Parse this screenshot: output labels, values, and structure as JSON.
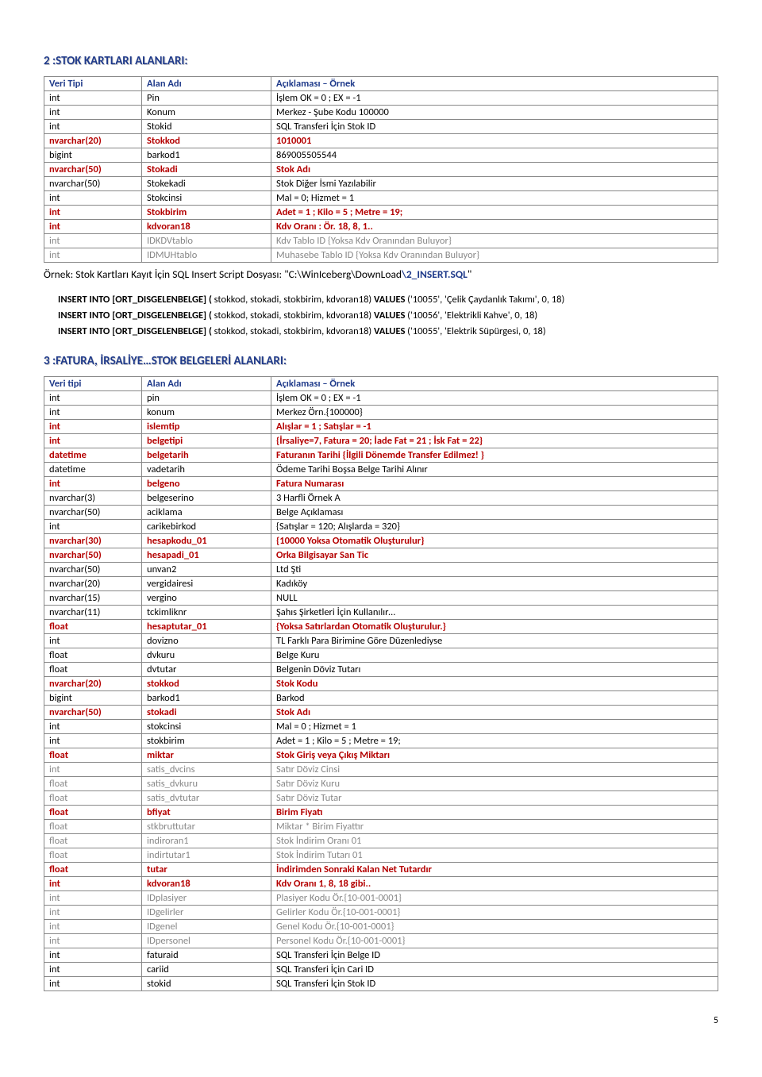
{
  "page_number": "5",
  "section2": {
    "heading": "2 :STOK KARTLARI ALANLARI:",
    "headers": {
      "type": "Veri Tipi",
      "name": "Alan Adı",
      "desc": "Açıklaması – Örnek"
    },
    "rows": [
      {
        "type": "int",
        "name": "Pin",
        "desc": "İşlem OK = 0 ; EX = -1",
        "cls": ""
      },
      {
        "type": "int",
        "name": "Konum",
        "desc": "Merkez - Şube Kodu 100000",
        "cls": ""
      },
      {
        "type": "int",
        "name": "Stokid",
        "desc": "SQL Transferi İçin Stok ID",
        "cls": ""
      },
      {
        "type": "nvarchar(20)",
        "name": "Stokkod",
        "desc": "1010001",
        "cls": "redrow"
      },
      {
        "type": "bigint",
        "name": "barkod1",
        "desc": "869005505544",
        "cls": ""
      },
      {
        "type": "nvarchar(50)",
        "name": "Stokadi",
        "desc": "Stok Adı",
        "cls": "redrow"
      },
      {
        "type": "nvarchar(50)",
        "name": "Stokekadi",
        "desc": "Stok Diğer İsmi Yazılabilir",
        "cls": ""
      },
      {
        "type": "int",
        "name": "Stokcinsi",
        "desc": "Mal = 0; Hizmet = 1",
        "cls": ""
      },
      {
        "type": "int",
        "name": "Stokbirim",
        "desc": "Adet = 1 ; Kilo = 5 ; Metre = 19;",
        "cls": "redrow"
      },
      {
        "type": "int",
        "name": "kdvoran18",
        "desc": "Kdv Oranı : Ör. 18, 8, 1..",
        "cls": "redrow"
      },
      {
        "type": "int",
        "name": "IDKDVtablo",
        "desc": "Kdv Tablo ID {Yoksa Kdv Oranından Buluyor}",
        "cls": "grayrow"
      },
      {
        "type": "int",
        "name": "IDMUHtablo",
        "desc": "Muhasebe Tablo ID {Yoksa Kdv Oranından Buluyor}",
        "cls": "grayrow"
      }
    ],
    "example_prefix": "Örnek: Stok Kartları Kayıt İçin SQL Insert Script Dosyası: \"C:\\WinIceberg\\DownLoad",
    "example_bold": "\\2_INSERT.SQL",
    "example_suffix": "\"",
    "sql": [
      {
        "k1": "INSERT INTO [ORT_DISGELENBELGE]",
        "k2": "(",
        "mid": " stokkod, stokadi, stokbirim, kdvoran18) ",
        "k3": "VALUES",
        "tail": " ('10055', 'Çelik Çaydanlık Takımı', 0, 18)"
      },
      {
        "k1": "INSERT INTO [ORT_DISGELENBELGE]",
        "k2": "(",
        "mid": " stokkod, stokadi, stokbirim, kdvoran18) ",
        "k3": "VALUES",
        "tail": " ('10056', 'Elektrikli Kahve', 0, 18)"
      },
      {
        "k1": "INSERT INTO [ORT_DISGELENBELGE]",
        "k2": "(",
        "mid": " stokkod, stokadi, stokbirim, kdvoran18) ",
        "k3": "VALUES",
        "tail": " ('10055', 'Elektrik Süpürgesi, 0, 18)"
      }
    ]
  },
  "section3": {
    "heading": "3 :FATURA, İRSALİYE…STOK BELGELERİ ALANLARI:",
    "headers": {
      "type": "Veri tipi",
      "name": "Alan Adı",
      "desc": "Açıklaması – Örnek"
    },
    "rows": [
      {
        "type": "int",
        "name": "pin",
        "desc": "İşlem OK = 0 ; EX = -1",
        "cls": ""
      },
      {
        "type": "int",
        "name": "konum",
        "desc": "Merkez Örn.{100000}",
        "cls": ""
      },
      {
        "type": "int",
        "name": "islemtip",
        "desc": "Alışlar = 1 ; Satışlar = -1",
        "cls": "redrow"
      },
      {
        "type": "int",
        "name": "belgetipi",
        "desc": "{İrsaliye=7, Fatura = 20; İade Fat = 21 ; İsk Fat = 22}",
        "cls": "redrow"
      },
      {
        "type": "datetime",
        "name": "belgetarih",
        "desc": "Faturanın Tarihi {İlgili Dönemde Transfer Edilmez! }",
        "cls": "redrow"
      },
      {
        "type": "datetime",
        "name": "vadetarih",
        "desc": "Ödeme Tarihi Boşsa Belge Tarihi Alınır",
        "cls": ""
      },
      {
        "type": "int",
        "name": "belgeno",
        "desc": "Fatura Numarası",
        "cls": "redrow"
      },
      {
        "type": "nvarchar(3)",
        "name": "belgeserino",
        "desc": "3 Harfli Örnek A",
        "cls": ""
      },
      {
        "type": "nvarchar(50)",
        "name": "aciklama",
        "desc": "Belge Açıklaması",
        "cls": ""
      },
      {
        "type": "int",
        "name": "carikebirkod",
        "desc": "{Satışlar = 120; Alışlarda = 320}",
        "cls": ""
      },
      {
        "type": "nvarchar(30)",
        "name": "hesapkodu_01",
        "desc": "{10000 Yoksa Otomatik Oluşturulur}",
        "cls": "redrow"
      },
      {
        "type": "nvarchar(50)",
        "name": "hesapadi_01",
        "desc": "Orka Bilgisayar San Tic",
        "cls": "redrow"
      },
      {
        "type": "nvarchar(50)",
        "name": "unvan2",
        "desc": "Ltd Şti",
        "cls": ""
      },
      {
        "type": "nvarchar(20)",
        "name": "vergidairesi",
        "desc": "Kadıköy",
        "cls": ""
      },
      {
        "type": "nvarchar(15)",
        "name": "vergino",
        "desc": "NULL",
        "cls": ""
      },
      {
        "type": "nvarchar(11)",
        "name": "tckimliknr",
        "desc": "Şahıs Şirketleri İçin Kullanılır…",
        "cls": ""
      },
      {
        "type": "float",
        "name": "hesaptutar_01",
        "desc": "{Yoksa Satırlardan Otomatik Oluşturulur.}",
        "cls": "redrow"
      },
      {
        "type": "int",
        "name": "dovizno",
        "desc": "TL Farklı Para Birimine Göre Düzenlediyse",
        "cls": ""
      },
      {
        "type": "float",
        "name": "dvkuru",
        "desc": "Belge Kuru",
        "cls": ""
      },
      {
        "type": "float",
        "name": "dvtutar",
        "desc": "Belgenin Döviz Tutarı",
        "cls": ""
      },
      {
        "type": "nvarchar(20)",
        "name": "stokkod",
        "desc": "Stok Kodu",
        "cls": "redrow"
      },
      {
        "type": "bigint",
        "name": "barkod1",
        "desc": "Barkod",
        "cls": ""
      },
      {
        "type": "nvarchar(50)",
        "name": "stokadi",
        "desc": "Stok Adı",
        "cls": "redrow"
      },
      {
        "type": "int",
        "name": "stokcinsi",
        "desc": "Mal = 0 ; Hizmet = 1",
        "cls": ""
      },
      {
        "type": "int",
        "name": "stokbirim",
        "desc": "Adet = 1 ; Kilo = 5 ; Metre = 19;",
        "cls": ""
      },
      {
        "type": "float",
        "name": "miktar",
        "desc": "Stok Giriş veya Çıkış Miktarı",
        "cls": "redrow"
      },
      {
        "type": "int",
        "name": "satis_dvcins",
        "desc": "Satır Döviz Cinsi",
        "cls": "grayrow"
      },
      {
        "type": "float",
        "name": "satis_dvkuru",
        "desc": "Satır Döviz Kuru",
        "cls": "grayrow"
      },
      {
        "type": "float",
        "name": "satis_dvtutar",
        "desc": "Satır Döviz Tutar",
        "cls": "grayrow"
      },
      {
        "type": "float",
        "name": "bfiyat",
        "desc": "Birim Fiyatı",
        "cls": "redrow"
      },
      {
        "type": "float",
        "name": "stkbruttutar",
        "desc": "Miktar * Birim Fiyattır",
        "cls": "grayrow"
      },
      {
        "type": "float",
        "name": "indiroran1",
        "desc": "Stok İndirim Oranı 01",
        "cls": "grayrow"
      },
      {
        "type": "float",
        "name": "indirtutar1",
        "desc": "Stok İndirim Tutarı 01",
        "cls": "grayrow"
      },
      {
        "type": "float",
        "name": "tutar",
        "desc": "İndirimden Sonraki Kalan Net Tutardır",
        "cls": "redrow"
      },
      {
        "type": "int",
        "name": "kdvoran18",
        "desc": "Kdv Oranı 1, 8, 18 gibi..",
        "cls": "redrow"
      },
      {
        "type": "int",
        "name": "IDplasiyer",
        "desc": "Plasiyer Kodu Ör.{10-001-0001}",
        "cls": "grayrow"
      },
      {
        "type": "int",
        "name": "IDgelirler",
        "desc": "Gelirler Kodu Ör.{10-001-0001}",
        "cls": "grayrow"
      },
      {
        "type": "int",
        "name": "IDgenel",
        "desc": "Genel Kodu Ör.{10-001-0001}",
        "cls": "grayrow"
      },
      {
        "type": "int",
        "name": "IDpersonel",
        "desc": "Personel Kodu Ör.{10-001-0001}",
        "cls": "grayrow"
      },
      {
        "type": "int",
        "name": "faturaid",
        "desc": "SQL Transferi İçin Belge ID",
        "cls": ""
      },
      {
        "type": "int",
        "name": "cariid",
        "desc": "SQL Transferi İçin Cari ID",
        "cls": ""
      },
      {
        "type": "int",
        "name": "stokid",
        "desc": "SQL Transferi İçin Stok ID",
        "cls": ""
      }
    ]
  }
}
